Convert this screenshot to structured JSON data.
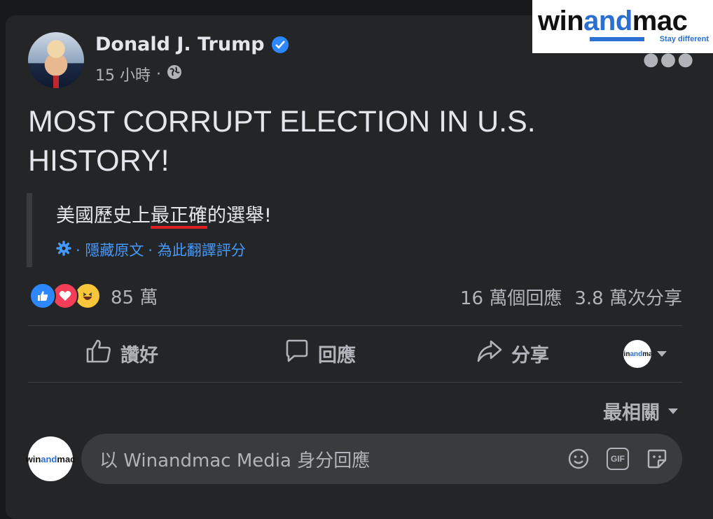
{
  "author": {
    "name": "Donald J. Trump",
    "time": "15 小時",
    "separator": "·"
  },
  "post": {
    "text": "MOST CORRUPT ELECTION IN U.S. HISTORY!",
    "translation_prefix": "美國歷史上",
    "translation_highlight": "最正確",
    "translation_suffix": "的選舉!",
    "translate_links": [
      " · 隱藏原文",
      " · 為此翻譯評分"
    ]
  },
  "reactions": {
    "count": "85 萬"
  },
  "stats": {
    "comments": "16 萬個回應",
    "shares": "3.8 萬次分享"
  },
  "actions": {
    "like": "讚好",
    "comment": "回應",
    "share": "分享"
  },
  "sort": {
    "label": "最相關"
  },
  "comment_box": {
    "placeholder": "以 Winandmac Media 身分回應",
    "gif": "GIF"
  },
  "brand": {
    "win": "win",
    "and": "and",
    "mac": "mac",
    "tagline": "Stay different"
  },
  "colors": {
    "accent": "#2d88ff",
    "link": "#4599ff",
    "underline": "#e02020"
  }
}
